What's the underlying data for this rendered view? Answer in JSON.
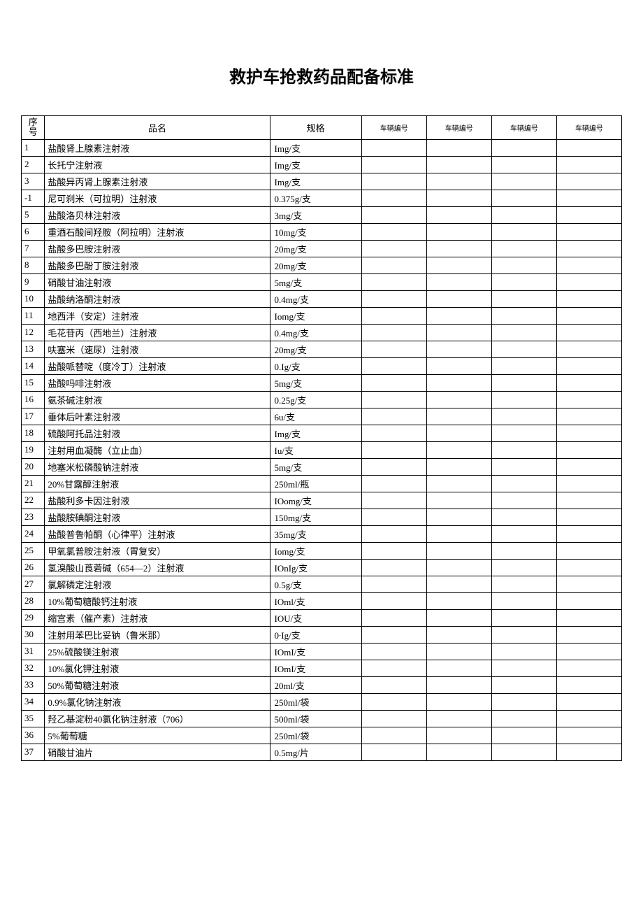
{
  "title": "救护车抢救药品配备标准",
  "headers": {
    "seq": "序号",
    "name": "品名",
    "spec": "规格",
    "veh1": "车辆编号",
    "veh2": "车辆编号",
    "veh3": "车辆编号",
    "veh4": "车辆编号"
  },
  "rows": [
    {
      "seq": "1",
      "name": "盐酸肾上腺素注射液",
      "spec": "Img/支"
    },
    {
      "seq": "2",
      "name": "长托宁注射液",
      "spec": "Img/支"
    },
    {
      "seq": "3",
      "name": "盐酸异丙肾上腺素注射液",
      "spec": "Img/支"
    },
    {
      "seq": "-1",
      "name": "尼可刹米（可拉明）注射液",
      "spec": "0.375g/支"
    },
    {
      "seq": "5",
      "name": "盐酸洛贝林注射液",
      "spec": "3mg/支"
    },
    {
      "seq": "6",
      "name": "重酒石酸间羟胺（阿拉明）注射液",
      "spec": "10mg/支"
    },
    {
      "seq": "7",
      "name": "盐酸多巴胺注射液",
      "spec": "20mg/支"
    },
    {
      "seq": "8",
      "name": "盐酸多巴酚丁胺注射液",
      "spec": "20mg/支"
    },
    {
      "seq": "9",
      "name": "硝酸甘油注射液",
      "spec": "5mg/支"
    },
    {
      "seq": "10",
      "name": "盐酸纳洛酮注射液",
      "spec": "0.4mg/支"
    },
    {
      "seq": "11",
      "name": "地西泮（安定）注射液",
      "spec": "Iomg/支"
    },
    {
      "seq": "12",
      "name": "毛花苷丙（西地兰）注射液",
      "spec": "0.4mg/支"
    },
    {
      "seq": "13",
      "name": "呋塞米（速尿）注射液",
      "spec": "20mg/支"
    },
    {
      "seq": "14",
      "name": "盐酸哌替啶（度冷丁）注射液",
      "spec": "0.Ig/支"
    },
    {
      "seq": "15",
      "name": "盐酸吗啡注射液",
      "spec": "5mg/支"
    },
    {
      "seq": "16",
      "name": "氨茶碱注射液",
      "spec": "0.25g/支"
    },
    {
      "seq": "17",
      "name": "垂体后叶素注射液",
      "spec": "6u/支"
    },
    {
      "seq": "18",
      "name": "硫酸阿托品注射液",
      "spec": "Img/支"
    },
    {
      "seq": "19",
      "name": "注射用血凝酶（立止血）",
      "spec": "Iu/支"
    },
    {
      "seq": "20",
      "name": "地塞米松磷酸钠注射液",
      "spec": "5mg/支"
    },
    {
      "seq": "21",
      "name": "20%甘露醇注射液",
      "spec": "250ml/瓶"
    },
    {
      "seq": "22",
      "name": "盐酸利多卡因注射液",
      "spec": "IOomg/支"
    },
    {
      "seq": "23",
      "name": "盐酸胺碘酮注射液",
      "spec": "150mg/支"
    },
    {
      "seq": "24",
      "name": "盐酸普鲁帕酮（心律平）注射液",
      "spec": "35mg/支"
    },
    {
      "seq": "25",
      "name": "甲氧氯普胺注射液（胃复安）",
      "spec": "Iomg/支"
    },
    {
      "seq": "26",
      "name": "氢溴酸山莨菪碱（654—2）注射液",
      "spec": "IOnIg/支"
    },
    {
      "seq": "27",
      "name": "氯解磷定注射液",
      "spec": "0.5g/支"
    },
    {
      "seq": "28",
      "name": "10%葡萄糖酸钙注射液",
      "spec": "IOml/支"
    },
    {
      "seq": "29",
      "name": "缩宫素（催产素）注射液",
      "spec": "IOU/支"
    },
    {
      "seq": "30",
      "name": "注射用苯巴比妥钠（鲁米那）",
      "spec": "0∙Ig/支"
    },
    {
      "seq": "31",
      "name": "25%硫酸镁注射液",
      "spec": "IOmI/支"
    },
    {
      "seq": "32",
      "name": "10%氯化钾注射液",
      "spec": "IOmI/支"
    },
    {
      "seq": "33",
      "name": "50%葡萄糖注射液",
      "spec": "20ml/支"
    },
    {
      "seq": "34",
      "name": "0.9%氯化钠注射液",
      "spec": "250ml/袋"
    },
    {
      "seq": "35",
      "name": "羟乙基淀粉40氯化钠注射液（706）",
      "spec": "500ml/袋"
    },
    {
      "seq": "36",
      "name": "5%葡萄糖",
      "spec": "250ml/袋"
    },
    {
      "seq": "37",
      "name": "硝酸甘油片",
      "spec": "0.5mg/片"
    }
  ]
}
